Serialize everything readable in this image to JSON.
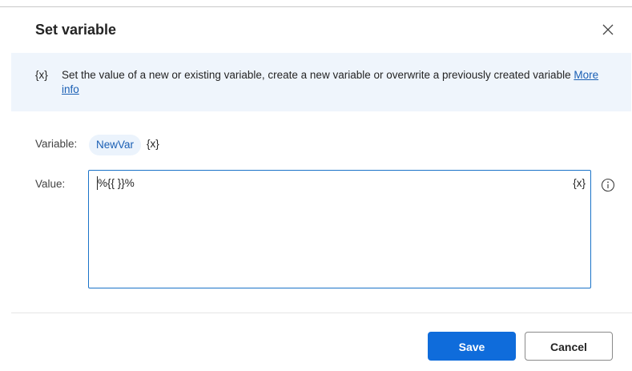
{
  "dialog": {
    "title": "Set variable",
    "close_icon": "close-icon"
  },
  "banner": {
    "icon_text": "{x}",
    "text": "Set the value of a new or existing variable, create a new variable or overwrite a previously created variable ",
    "link_text": "More info"
  },
  "variable": {
    "label": "Variable:",
    "name": "NewVar",
    "picker_icon_text": "{x}"
  },
  "value": {
    "label": "Value:",
    "text": "%{{ }}%",
    "picker_icon_text": "{x}",
    "info_icon": "info-icon"
  },
  "footer": {
    "save_label": "Save",
    "cancel_label": "Cancel"
  },
  "colors": {
    "accent": "#0f6cdb",
    "banner_bg": "#eff5fc",
    "chip_bg": "#ebf3fc",
    "link": "#1a5fb4"
  }
}
